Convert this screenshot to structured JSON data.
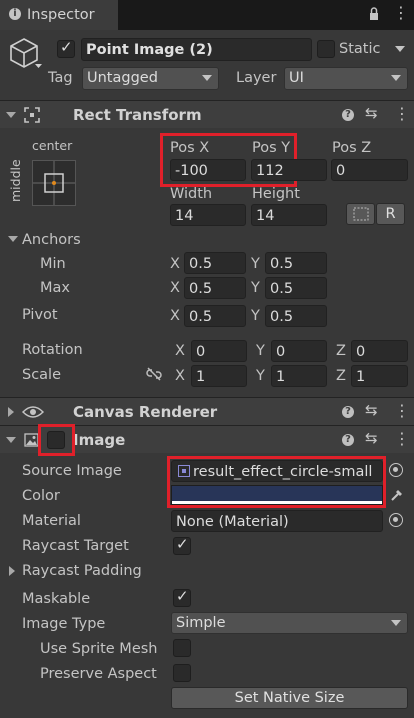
{
  "tab": {
    "title": "Inspector"
  },
  "object": {
    "active": true,
    "name": "Point Image (2)",
    "static_label": "Static",
    "tag_label": "Tag",
    "tag_value": "Untagged",
    "layer_label": "Layer",
    "layer_value": "UI"
  },
  "rect_transform": {
    "title": "Rect Transform",
    "anchor_h": "center",
    "anchor_v": "middle",
    "posx_label": "Pos X",
    "posx": "-100",
    "posy_label": "Pos Y",
    "posy": "112",
    "posz_label": "Pos Z",
    "posz": "0",
    "width_label": "Width",
    "width": "14",
    "height_label": "Height",
    "height": "14",
    "r_button": "R",
    "anchors_label": "Anchors",
    "min_label": "Min",
    "min_x": "0.5",
    "min_y": "0.5",
    "max_label": "Max",
    "max_x": "0.5",
    "max_y": "0.5",
    "pivot_label": "Pivot",
    "pivot_x": "0.5",
    "pivot_y": "0.5",
    "rotation_label": "Rotation",
    "rot_x": "0",
    "rot_y": "0",
    "rot_z": "0",
    "scale_label": "Scale",
    "scale_x": "1",
    "scale_y": "1",
    "scale_z": "1",
    "x": "X",
    "y": "Y",
    "z": "Z"
  },
  "canvas_renderer": {
    "title": "Canvas Renderer"
  },
  "image": {
    "title": "Image",
    "enabled": false,
    "source_label": "Source Image",
    "source_value": "result_effect_circle-small",
    "color_label": "Color",
    "color_value": "#283558",
    "material_label": "Material",
    "material_value": "None (Material)",
    "raycast_target_label": "Raycast Target",
    "raycast_target": true,
    "raycast_padding_label": "Raycast Padding",
    "maskable_label": "Maskable",
    "maskable": true,
    "image_type_label": "Image Type",
    "image_type_value": "Simple",
    "use_sprite_mesh_label": "Use Sprite Mesh",
    "use_sprite_mesh": false,
    "preserve_aspect_label": "Preserve Aspect",
    "preserve_aspect": false,
    "native_size_button": "Set Native Size"
  },
  "colors": {
    "highlight": "#e0202a",
    "background": "#383838",
    "field": "#2a2a2a"
  }
}
